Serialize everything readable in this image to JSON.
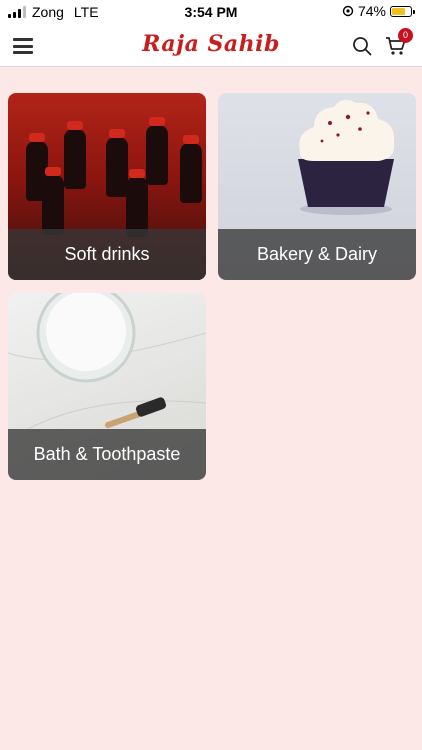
{
  "status_bar": {
    "carrier": "Zong",
    "network": "LTE",
    "time": "3:54 PM",
    "battery": "74%"
  },
  "header": {
    "brand": "Raja Sahib",
    "cart_count": "0"
  },
  "categories": [
    {
      "label": "Soft drinks"
    },
    {
      "label": "Bakery & Dairy"
    },
    {
      "label": "Bath & Toothpaste"
    }
  ],
  "colors": {
    "brand": "#c81e1e",
    "background": "#fde8e8",
    "badge": "#c8101e"
  },
  "icons": [
    "menu-icon",
    "search-icon",
    "cart-icon",
    "signal-icon",
    "location-icon",
    "battery-icon"
  ]
}
